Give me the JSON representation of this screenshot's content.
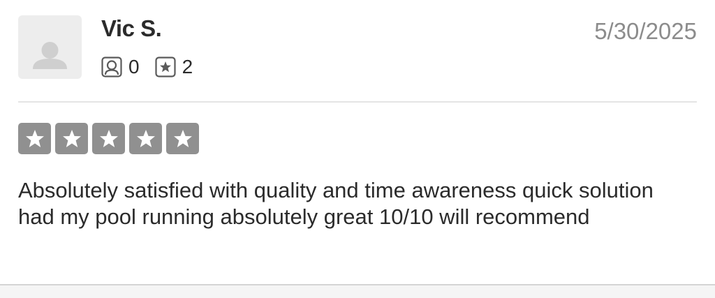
{
  "review": {
    "reviewer_name": "Vic S.",
    "date": "5/30/2025",
    "stats": {
      "friends_count": "0",
      "reviews_count": "2"
    },
    "rating": 5,
    "rating_max": 5,
    "text": "Absolutely satisfied with quality and time awareness quick solution had my pool running absolutely great 10/10 will recommend"
  },
  "icons": {
    "avatar": "default-user-avatar-icon",
    "friends": "friends-icon",
    "reviews": "reviews-star-icon",
    "rating_star": "star-icon"
  },
  "colors": {
    "star_filled": "#909090",
    "star_empty": "#dcdcdc",
    "date_text": "#8c8c8c",
    "avatar_bg": "#ededed"
  }
}
